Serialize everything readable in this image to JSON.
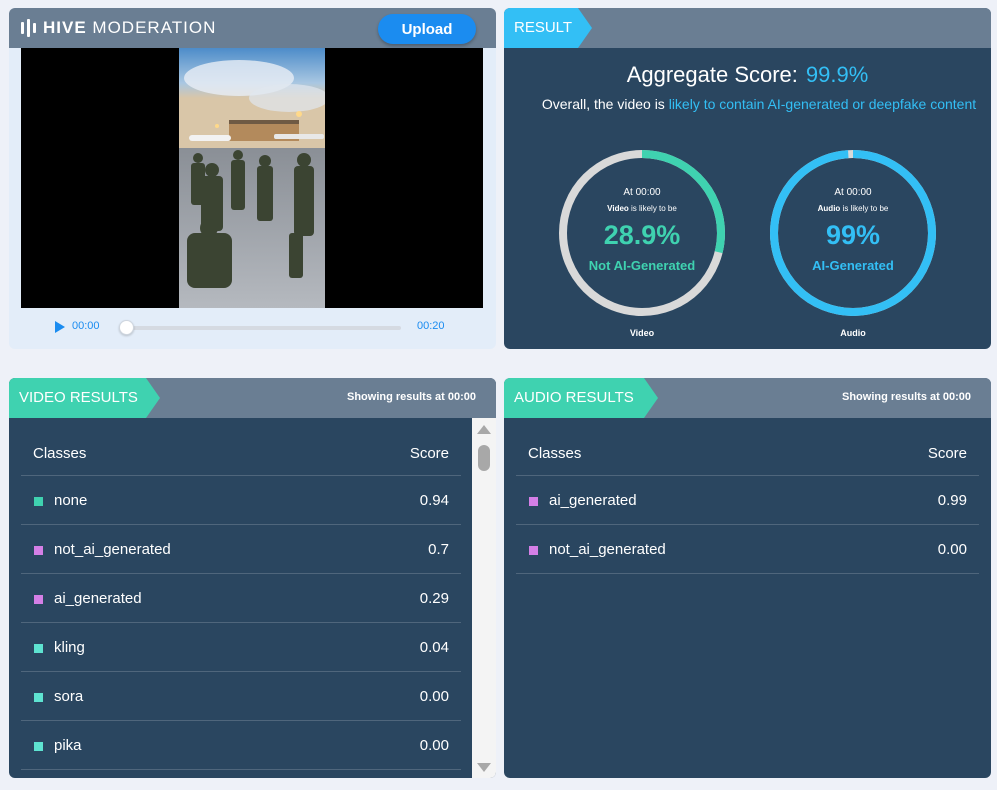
{
  "brand": {
    "bold": "HIVE",
    "light": "MODERATION"
  },
  "upload_label": "Upload",
  "player": {
    "current_time": "00:00",
    "duration": "00:20",
    "progress": 0
  },
  "result": {
    "tab": "RESULT",
    "aggregate_label": "Aggregate Score:",
    "aggregate_value": "99.9%",
    "overall_prefix": "Overall, the video is",
    "overall_highlight": "likely to contain AI-generated or deepfake content",
    "gauges": [
      {
        "at": "At 00:00",
        "media": "Video",
        "likely_text": "is likely to be",
        "percent": "28.9%",
        "fill": 0.289,
        "label": "Not AI-Generated",
        "caption": "Video",
        "color": "#3fd2b0"
      },
      {
        "at": "At 00:00",
        "media": "Audio",
        "likely_text": "is likely to be",
        "percent": "99%",
        "fill": 0.99,
        "label": "AI-Generated",
        "caption": "Audio",
        "color": "#33bff5"
      }
    ]
  },
  "video_results": {
    "tab": "VIDEO RESULTS",
    "showing_prefix": "Showing results at",
    "showing_time": "00:00",
    "col_classes": "Classes",
    "col_score": "Score",
    "rows": [
      {
        "cls": "none",
        "score": "0.94",
        "color": "#3fd2b0"
      },
      {
        "cls": "not_ai_generated",
        "score": "0.7",
        "color": "#d47fe6"
      },
      {
        "cls": "ai_generated",
        "score": "0.29",
        "color": "#d47fe6"
      },
      {
        "cls": "kling",
        "score": "0.04",
        "color": "#5ee3d1"
      },
      {
        "cls": "sora",
        "score": "0.00",
        "color": "#5ee3d1"
      },
      {
        "cls": "pika",
        "score": "0.00",
        "color": "#5ee3d1"
      }
    ]
  },
  "audio_results": {
    "tab": "AUDIO RESULTS",
    "showing_prefix": "Showing results at",
    "showing_time": "00:00",
    "col_classes": "Classes",
    "col_score": "Score",
    "rows": [
      {
        "cls": "ai_generated",
        "score": "0.99",
        "color": "#d47fe6"
      },
      {
        "cls": "not_ai_generated",
        "score": "0.00",
        "color": "#d47fe6"
      }
    ]
  },
  "colors": {
    "header": "#6a7e93",
    "panel": "#2a4660",
    "teal": "#3fd2b0",
    "blue": "#33bff5",
    "accent": "#1b8cf0"
  }
}
